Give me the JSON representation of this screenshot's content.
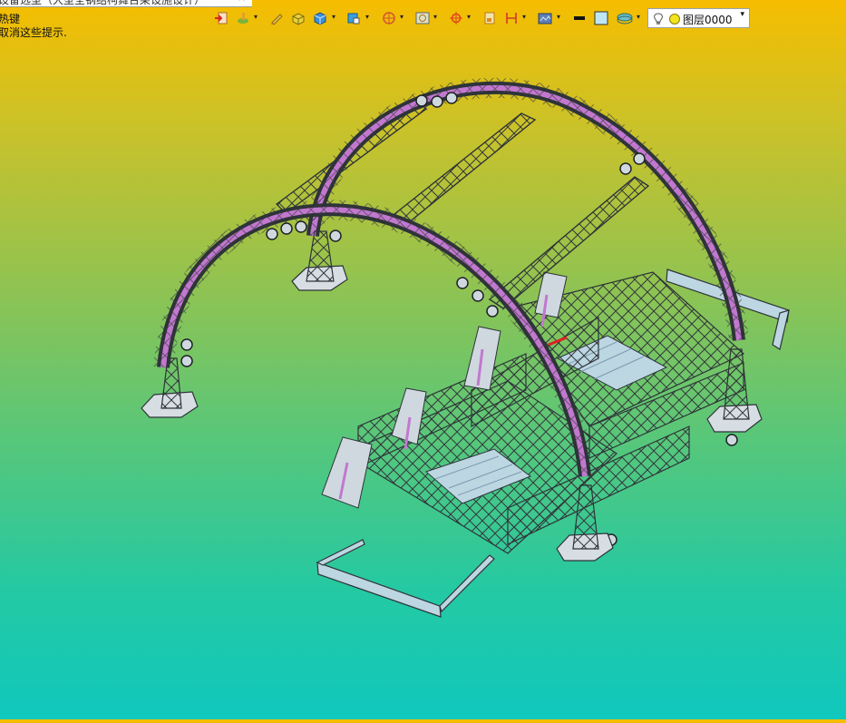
{
  "tab": {
    "title": "设备选型（大型全钢结构舞台架设施设计）",
    "close": "×"
  },
  "hints": {
    "line1": "热键",
    "line2": "取消这些提示."
  },
  "toolbar": {
    "icons": [
      "exit-icon",
      "paint-icon",
      "pen-icon",
      "block-icon",
      "box-icon",
      "cube-blue-icon",
      "sphere-icon",
      "image-icon",
      "target-icon",
      "page-icon",
      "dimension-icon",
      "render-icon",
      "line-color-icon",
      "fill-color-icon",
      "layers-icon"
    ],
    "dropdown_arrow": "▾"
  },
  "layer": {
    "name": "图层0000",
    "arrow": "▾"
  },
  "colors": {
    "arch": "#c278cf",
    "steel": "#4a4e55",
    "plate": "#bcd6e2",
    "base": "#d6dde3"
  }
}
